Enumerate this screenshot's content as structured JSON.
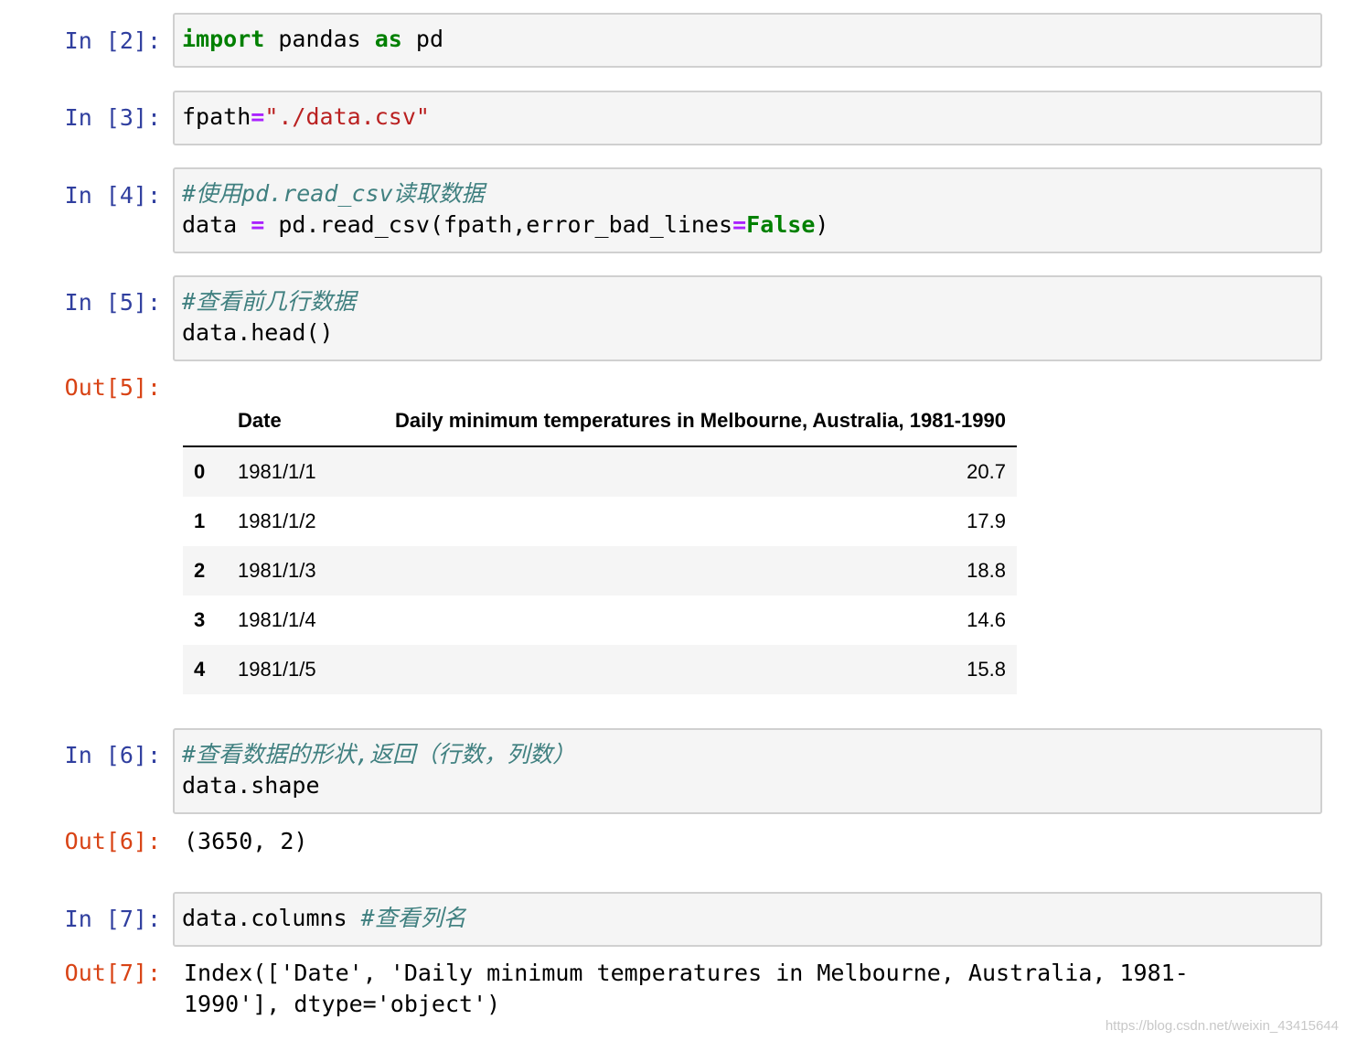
{
  "cells": [
    {
      "prompt": "In [2]:",
      "tokens": [
        {
          "t": "import",
          "c": "kw"
        },
        {
          "t": " pandas ",
          "c": ""
        },
        {
          "t": "as",
          "c": "kw"
        },
        {
          "t": " pd",
          "c": ""
        }
      ]
    },
    {
      "prompt": "In [3]:",
      "tokens": [
        {
          "t": "fpath",
          "c": ""
        },
        {
          "t": "=",
          "c": "op"
        },
        {
          "t": "\"./data.csv\"",
          "c": "str"
        }
      ]
    },
    {
      "prompt": "In [4]:",
      "comment": "#使用pd.read_csv读取数据",
      "tokens": [
        {
          "t": "data ",
          "c": ""
        },
        {
          "t": "=",
          "c": "op"
        },
        {
          "t": " pd.read_csv(fpath,error_bad_lines",
          "c": ""
        },
        {
          "t": "=",
          "c": "op"
        },
        {
          "t": "False",
          "c": "kw"
        },
        {
          "t": ")",
          "c": ""
        }
      ]
    },
    {
      "prompt": "In [5]:",
      "comment": "#查看前几行数据",
      "code": "data.head()"
    },
    {
      "prompt": "In [6]:",
      "comment": "#查看数据的形状,返回（行数，列数）",
      "code": "data.shape"
    },
    {
      "prompt": "In [7]:",
      "code": "data.columns ",
      "trailing_comment": "#查看列名"
    }
  ],
  "outputs": {
    "out5_prompt": "Out[5]:",
    "out6_prompt": "Out[6]:",
    "out6_text": "(3650, 2)",
    "out7_prompt": "Out[7]:",
    "out7_line1": "Index(['Date', 'Daily minimum temperatures in Melbourne, Australia, 1981-",
    "out7_line2": "1990'], dtype='object')"
  },
  "dataframe": {
    "columns": [
      "",
      "Date",
      "Daily minimum temperatures in Melbourne, Australia, 1981-1990"
    ],
    "rows": [
      {
        "index": "0",
        "date": "1981/1/1",
        "value": "20.7"
      },
      {
        "index": "1",
        "date": "1981/1/2",
        "value": "17.9"
      },
      {
        "index": "2",
        "date": "1981/1/3",
        "value": "18.8"
      },
      {
        "index": "3",
        "date": "1981/1/4",
        "value": "14.6"
      },
      {
        "index": "4",
        "date": "1981/1/5",
        "value": "15.8"
      }
    ]
  },
  "watermark": "https://blog.csdn.net/weixin_43415644"
}
